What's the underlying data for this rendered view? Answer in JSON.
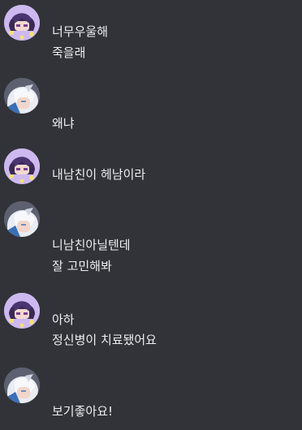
{
  "messages": [
    {
      "avatar": "purple-hair-avatar",
      "lines": [
        "너무우울해",
        "죽을래"
      ]
    },
    {
      "avatar": "white-hair-avatar",
      "lines": [
        "왜냐"
      ]
    },
    {
      "avatar": "purple-hair-avatar",
      "lines": [
        "내남친이 헤남이라"
      ]
    },
    {
      "avatar": "white-hair-avatar",
      "lines": [
        "니남친아닐텐데",
        "잘 고민해봐"
      ]
    },
    {
      "avatar": "purple-hair-avatar",
      "lines": [
        "아하",
        "정신병이 치료됐어요"
      ]
    },
    {
      "avatar": "white-hair-avatar",
      "lines": [
        "보기좋아요!"
      ]
    }
  ],
  "colors": {
    "background": "#313338",
    "text": "#eceef1"
  }
}
